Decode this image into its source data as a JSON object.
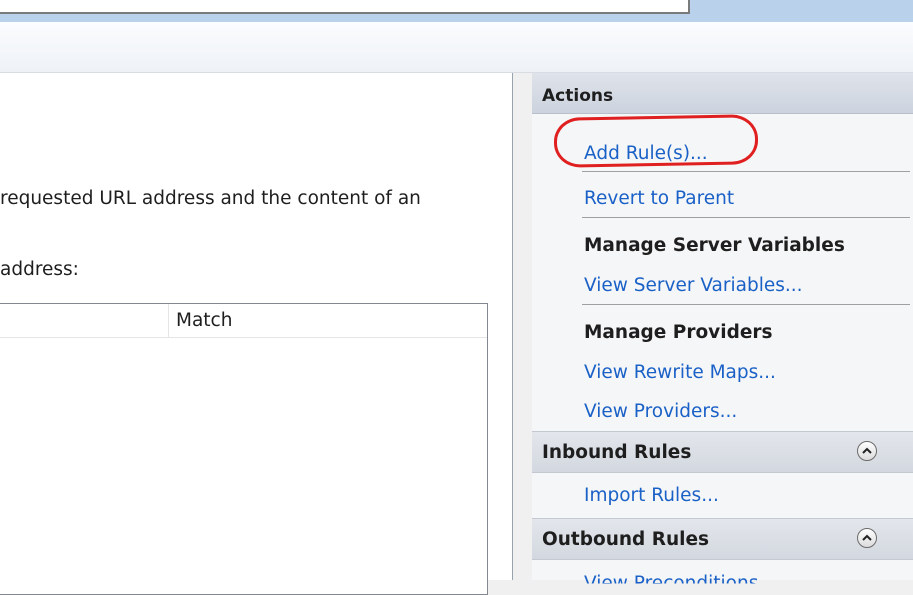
{
  "content": {
    "description_line": "requested URL address and the content of an",
    "sub_label": "address:",
    "list_header_match": "Match"
  },
  "actions": {
    "title": "Actions",
    "add_rules": "Add Rule(s)...",
    "revert_to_parent": "Revert to Parent",
    "manage_server_variables": "Manage Server Variables",
    "view_server_variables": "View Server Variables...",
    "manage_providers": "Manage Providers",
    "view_rewrite_maps": "View Rewrite Maps...",
    "view_providers": "View Providers...",
    "inbound_rules": "Inbound Rules",
    "import_rules": "Import Rules...",
    "outbound_rules": "Outbound Rules",
    "view_preconditions": "View Preconditions..."
  },
  "colors": {
    "link": "#1a61c7",
    "highlight": "#e02020"
  }
}
